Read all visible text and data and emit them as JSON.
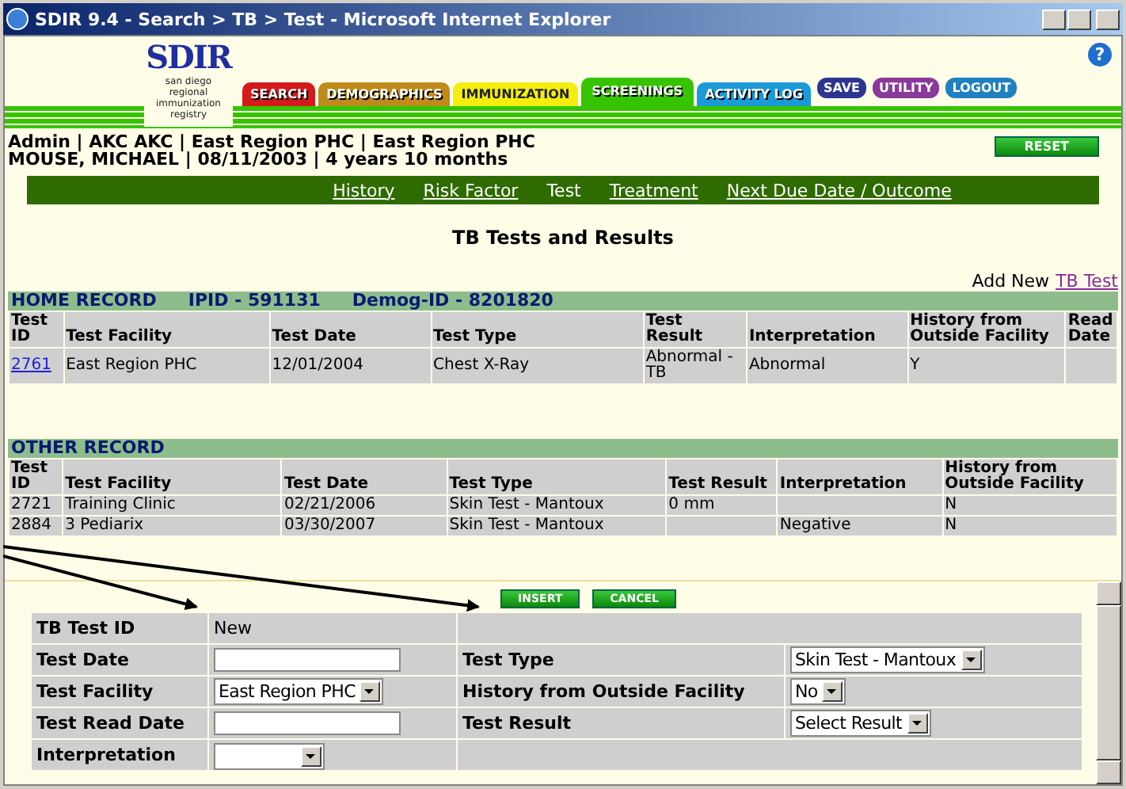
{
  "window": {
    "title": "SDIR 9.4 - Search > TB > Test - Microsoft Internet Explorer"
  },
  "logo": {
    "text": "SDIR",
    "subtitle": "san diego regional immunization registry"
  },
  "help": {
    "label": "?"
  },
  "tabs": [
    {
      "label": "SEARCH",
      "color": "#d41a1a",
      "selected": false
    },
    {
      "label": "DEMOGRAPHICS",
      "color": "#c08a1c",
      "selected": false
    },
    {
      "label": "IMMUNIZATION",
      "color": "#f4ee10",
      "selected": false
    },
    {
      "label": "SCREENINGS",
      "color": "#36c400",
      "selected": true
    },
    {
      "label": "ACTIVITY LOG",
      "color": "#1c9ad8",
      "selected": false
    }
  ],
  "action_buttons": [
    {
      "label": "SAVE",
      "color": "#2c3590"
    },
    {
      "label": "UTILITY",
      "color": "#8a3a9a"
    },
    {
      "label": "LOGOUT",
      "color": "#2080c0"
    }
  ],
  "user_info": [
    "Admin | AKC AKC | East Region PHC | East Region PHC",
    "MOUSE, MICHAEL | 08/11/2003 | 4 years 10 months"
  ],
  "reset_button": "RESET",
  "subnav": [
    {
      "label": "History",
      "selected": false
    },
    {
      "label": "Risk Factor",
      "selected": false
    },
    {
      "label": "Test",
      "selected": true
    },
    {
      "label": "Treatment",
      "selected": false
    },
    {
      "label": "Next Due Date / Outcome",
      "selected": false
    }
  ],
  "page_title": "TB Tests and Results",
  "add_new": {
    "prefix": "Add New",
    "link": "TB Test"
  },
  "home_record": {
    "header": [
      "HOME RECORD",
      "IPID - 591131",
      "Demog-ID - 8201820"
    ],
    "columns": [
      "Test ID",
      "Test Facility",
      "Test Date",
      "Test Type",
      "Test Result",
      "Interpretation",
      "History from Outside Facility",
      "Read Date"
    ],
    "rows": [
      {
        "link": true,
        "cells": [
          "2761",
          "East Region PHC",
          "12/01/2004",
          "Chest X-Ray",
          "Abnormal - TB",
          "Abnormal",
          "Y",
          null
        ]
      }
    ]
  },
  "other_record": {
    "header": [
      "OTHER RECORD"
    ],
    "columns": [
      "Test ID",
      "Test Facility",
      "Test Date",
      "Test Type",
      "Test Result",
      "Interpretation",
      "History from Outside Facility"
    ],
    "rows": [
      {
        "link": false,
        "cells": [
          "2721",
          "Training Clinic",
          "02/21/2006",
          "Skin Test - Mantoux",
          "0 mm",
          null,
          "N"
        ]
      },
      {
        "link": false,
        "cells": [
          "2884",
          "3 Pediarix",
          "03/30/2007",
          "Skin Test - Mantoux",
          null,
          "Negative",
          "N"
        ]
      }
    ]
  },
  "form": {
    "buttons": [
      "INSERT",
      "CANCEL"
    ],
    "rows": [
      {
        "left": {
          "label": "TB Test ID",
          "kind": "static",
          "value": "New"
        }
      },
      {
        "left": {
          "label": "Test Date",
          "kind": "input"
        },
        "right": {
          "label": "Test Type",
          "kind": "select",
          "value": "Skin Test - Mantoux"
        }
      },
      {
        "left": {
          "label": "Test Facility",
          "kind": "select",
          "value": "East Region PHC"
        },
        "right": {
          "label": "History from Outside Facility",
          "kind": "select",
          "value": "No"
        }
      },
      {
        "left": {
          "label": "Test Read Date",
          "kind": "input"
        },
        "right": {
          "label": "Test Result",
          "kind": "select",
          "value": "Select Result"
        }
      },
      {
        "left": {
          "label": "Interpretation",
          "kind": "select"
        }
      }
    ]
  }
}
